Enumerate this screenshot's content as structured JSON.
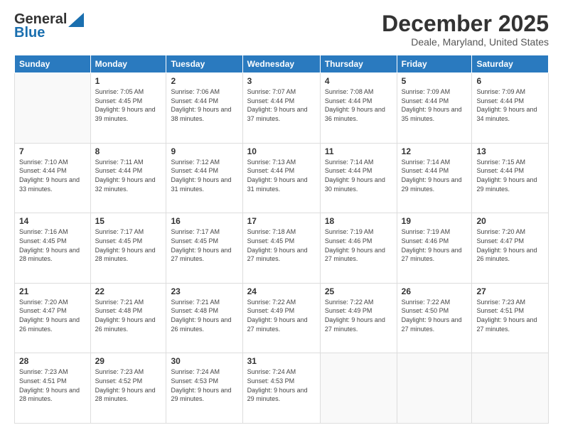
{
  "logo": {
    "line1": "General",
    "line2": "Blue"
  },
  "header": {
    "title": "December 2025",
    "subtitle": "Deale, Maryland, United States"
  },
  "days_of_week": [
    "Sunday",
    "Monday",
    "Tuesday",
    "Wednesday",
    "Thursday",
    "Friday",
    "Saturday"
  ],
  "weeks": [
    [
      {
        "num": "",
        "sunrise": "",
        "sunset": "",
        "daylight": ""
      },
      {
        "num": "1",
        "sunrise": "Sunrise: 7:05 AM",
        "sunset": "Sunset: 4:45 PM",
        "daylight": "Daylight: 9 hours and 39 minutes."
      },
      {
        "num": "2",
        "sunrise": "Sunrise: 7:06 AM",
        "sunset": "Sunset: 4:44 PM",
        "daylight": "Daylight: 9 hours and 38 minutes."
      },
      {
        "num": "3",
        "sunrise": "Sunrise: 7:07 AM",
        "sunset": "Sunset: 4:44 PM",
        "daylight": "Daylight: 9 hours and 37 minutes."
      },
      {
        "num": "4",
        "sunrise": "Sunrise: 7:08 AM",
        "sunset": "Sunset: 4:44 PM",
        "daylight": "Daylight: 9 hours and 36 minutes."
      },
      {
        "num": "5",
        "sunrise": "Sunrise: 7:09 AM",
        "sunset": "Sunset: 4:44 PM",
        "daylight": "Daylight: 9 hours and 35 minutes."
      },
      {
        "num": "6",
        "sunrise": "Sunrise: 7:09 AM",
        "sunset": "Sunset: 4:44 PM",
        "daylight": "Daylight: 9 hours and 34 minutes."
      }
    ],
    [
      {
        "num": "7",
        "sunrise": "Sunrise: 7:10 AM",
        "sunset": "Sunset: 4:44 PM",
        "daylight": "Daylight: 9 hours and 33 minutes."
      },
      {
        "num": "8",
        "sunrise": "Sunrise: 7:11 AM",
        "sunset": "Sunset: 4:44 PM",
        "daylight": "Daylight: 9 hours and 32 minutes."
      },
      {
        "num": "9",
        "sunrise": "Sunrise: 7:12 AM",
        "sunset": "Sunset: 4:44 PM",
        "daylight": "Daylight: 9 hours and 31 minutes."
      },
      {
        "num": "10",
        "sunrise": "Sunrise: 7:13 AM",
        "sunset": "Sunset: 4:44 PM",
        "daylight": "Daylight: 9 hours and 31 minutes."
      },
      {
        "num": "11",
        "sunrise": "Sunrise: 7:14 AM",
        "sunset": "Sunset: 4:44 PM",
        "daylight": "Daylight: 9 hours and 30 minutes."
      },
      {
        "num": "12",
        "sunrise": "Sunrise: 7:14 AM",
        "sunset": "Sunset: 4:44 PM",
        "daylight": "Daylight: 9 hours and 29 minutes."
      },
      {
        "num": "13",
        "sunrise": "Sunrise: 7:15 AM",
        "sunset": "Sunset: 4:44 PM",
        "daylight": "Daylight: 9 hours and 29 minutes."
      }
    ],
    [
      {
        "num": "14",
        "sunrise": "Sunrise: 7:16 AM",
        "sunset": "Sunset: 4:45 PM",
        "daylight": "Daylight: 9 hours and 28 minutes."
      },
      {
        "num": "15",
        "sunrise": "Sunrise: 7:17 AM",
        "sunset": "Sunset: 4:45 PM",
        "daylight": "Daylight: 9 hours and 28 minutes."
      },
      {
        "num": "16",
        "sunrise": "Sunrise: 7:17 AM",
        "sunset": "Sunset: 4:45 PM",
        "daylight": "Daylight: 9 hours and 27 minutes."
      },
      {
        "num": "17",
        "sunrise": "Sunrise: 7:18 AM",
        "sunset": "Sunset: 4:45 PM",
        "daylight": "Daylight: 9 hours and 27 minutes."
      },
      {
        "num": "18",
        "sunrise": "Sunrise: 7:19 AM",
        "sunset": "Sunset: 4:46 PM",
        "daylight": "Daylight: 9 hours and 27 minutes."
      },
      {
        "num": "19",
        "sunrise": "Sunrise: 7:19 AM",
        "sunset": "Sunset: 4:46 PM",
        "daylight": "Daylight: 9 hours and 27 minutes."
      },
      {
        "num": "20",
        "sunrise": "Sunrise: 7:20 AM",
        "sunset": "Sunset: 4:47 PM",
        "daylight": "Daylight: 9 hours and 26 minutes."
      }
    ],
    [
      {
        "num": "21",
        "sunrise": "Sunrise: 7:20 AM",
        "sunset": "Sunset: 4:47 PM",
        "daylight": "Daylight: 9 hours and 26 minutes."
      },
      {
        "num": "22",
        "sunrise": "Sunrise: 7:21 AM",
        "sunset": "Sunset: 4:48 PM",
        "daylight": "Daylight: 9 hours and 26 minutes."
      },
      {
        "num": "23",
        "sunrise": "Sunrise: 7:21 AM",
        "sunset": "Sunset: 4:48 PM",
        "daylight": "Daylight: 9 hours and 26 minutes."
      },
      {
        "num": "24",
        "sunrise": "Sunrise: 7:22 AM",
        "sunset": "Sunset: 4:49 PM",
        "daylight": "Daylight: 9 hours and 27 minutes."
      },
      {
        "num": "25",
        "sunrise": "Sunrise: 7:22 AM",
        "sunset": "Sunset: 4:49 PM",
        "daylight": "Daylight: 9 hours and 27 minutes."
      },
      {
        "num": "26",
        "sunrise": "Sunrise: 7:22 AM",
        "sunset": "Sunset: 4:50 PM",
        "daylight": "Daylight: 9 hours and 27 minutes."
      },
      {
        "num": "27",
        "sunrise": "Sunrise: 7:23 AM",
        "sunset": "Sunset: 4:51 PM",
        "daylight": "Daylight: 9 hours and 27 minutes."
      }
    ],
    [
      {
        "num": "28",
        "sunrise": "Sunrise: 7:23 AM",
        "sunset": "Sunset: 4:51 PM",
        "daylight": "Daylight: 9 hours and 28 minutes."
      },
      {
        "num": "29",
        "sunrise": "Sunrise: 7:23 AM",
        "sunset": "Sunset: 4:52 PM",
        "daylight": "Daylight: 9 hours and 28 minutes."
      },
      {
        "num": "30",
        "sunrise": "Sunrise: 7:24 AM",
        "sunset": "Sunset: 4:53 PM",
        "daylight": "Daylight: 9 hours and 29 minutes."
      },
      {
        "num": "31",
        "sunrise": "Sunrise: 7:24 AM",
        "sunset": "Sunset: 4:53 PM",
        "daylight": "Daylight: 9 hours and 29 minutes."
      },
      {
        "num": "",
        "sunrise": "",
        "sunset": "",
        "daylight": ""
      },
      {
        "num": "",
        "sunrise": "",
        "sunset": "",
        "daylight": ""
      },
      {
        "num": "",
        "sunrise": "",
        "sunset": "",
        "daylight": ""
      }
    ]
  ]
}
